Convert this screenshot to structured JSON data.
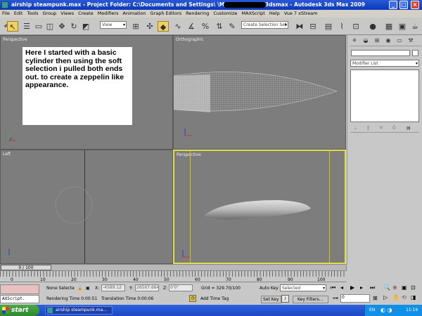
{
  "title": {
    "text": "airship steampunk.max    - Project Folder: C:\\Documents and Settings\\                 \\My Documents\\3dsmax    - Autodesk 3ds Max  2009"
  },
  "menu": [
    "File",
    "Edit",
    "Tools",
    "Group",
    "Views",
    "Create",
    "Modifiers",
    "Animation",
    "Graph Editors",
    "Rendering",
    "Customize",
    "MAXScript",
    "Help",
    "Vue 7 xStream"
  ],
  "toolbar": {
    "view_dropdown": "View",
    "selection_set": "Create Selection Set"
  },
  "viewports": {
    "top_left": "Perspective",
    "top_right": "Orthographic",
    "bottom_left": "Left",
    "bottom_right": "Perspective"
  },
  "note": "Here I started with a basic cylinder then using the soft selection i pulled both ends out. to create a zeppelin like appearance.",
  "cmdpanel": {
    "modifier_list": "Modifier List"
  },
  "timeline": {
    "frame": "0 / 100",
    "ticks": [
      "0",
      "10",
      "20",
      "30",
      "40",
      "50",
      "60",
      "70",
      "80",
      "90",
      "100"
    ]
  },
  "status": {
    "maxscript": "AXScript.",
    "selection": "None Selecte",
    "x_label": "X:",
    "x_value": "-4589.12",
    "y_label": "Y:",
    "y_value": "26507.664",
    "z_label": "Z:",
    "z_value": "0'0\"",
    "grid": "Grid = 329.70/100",
    "rendering_time": "Rendering Time  0:00:51",
    "translation_time": "Translation Time  0:00:06",
    "add_time_tag": "Add Time Tag",
    "auto_key": "Auto Key",
    "set_key": "Set Key",
    "key_mode": "Selected",
    "key_filters": "Key Filters...",
    "frame_field": "0"
  },
  "taskbar": {
    "start": "start",
    "task": "airship steampunk.ma...",
    "lang": "EN",
    "clock": "11:16"
  },
  "colors": {
    "viewport": "#7d7d7d",
    "active_border": "#e4de4a",
    "title": "#0a3ab8"
  }
}
